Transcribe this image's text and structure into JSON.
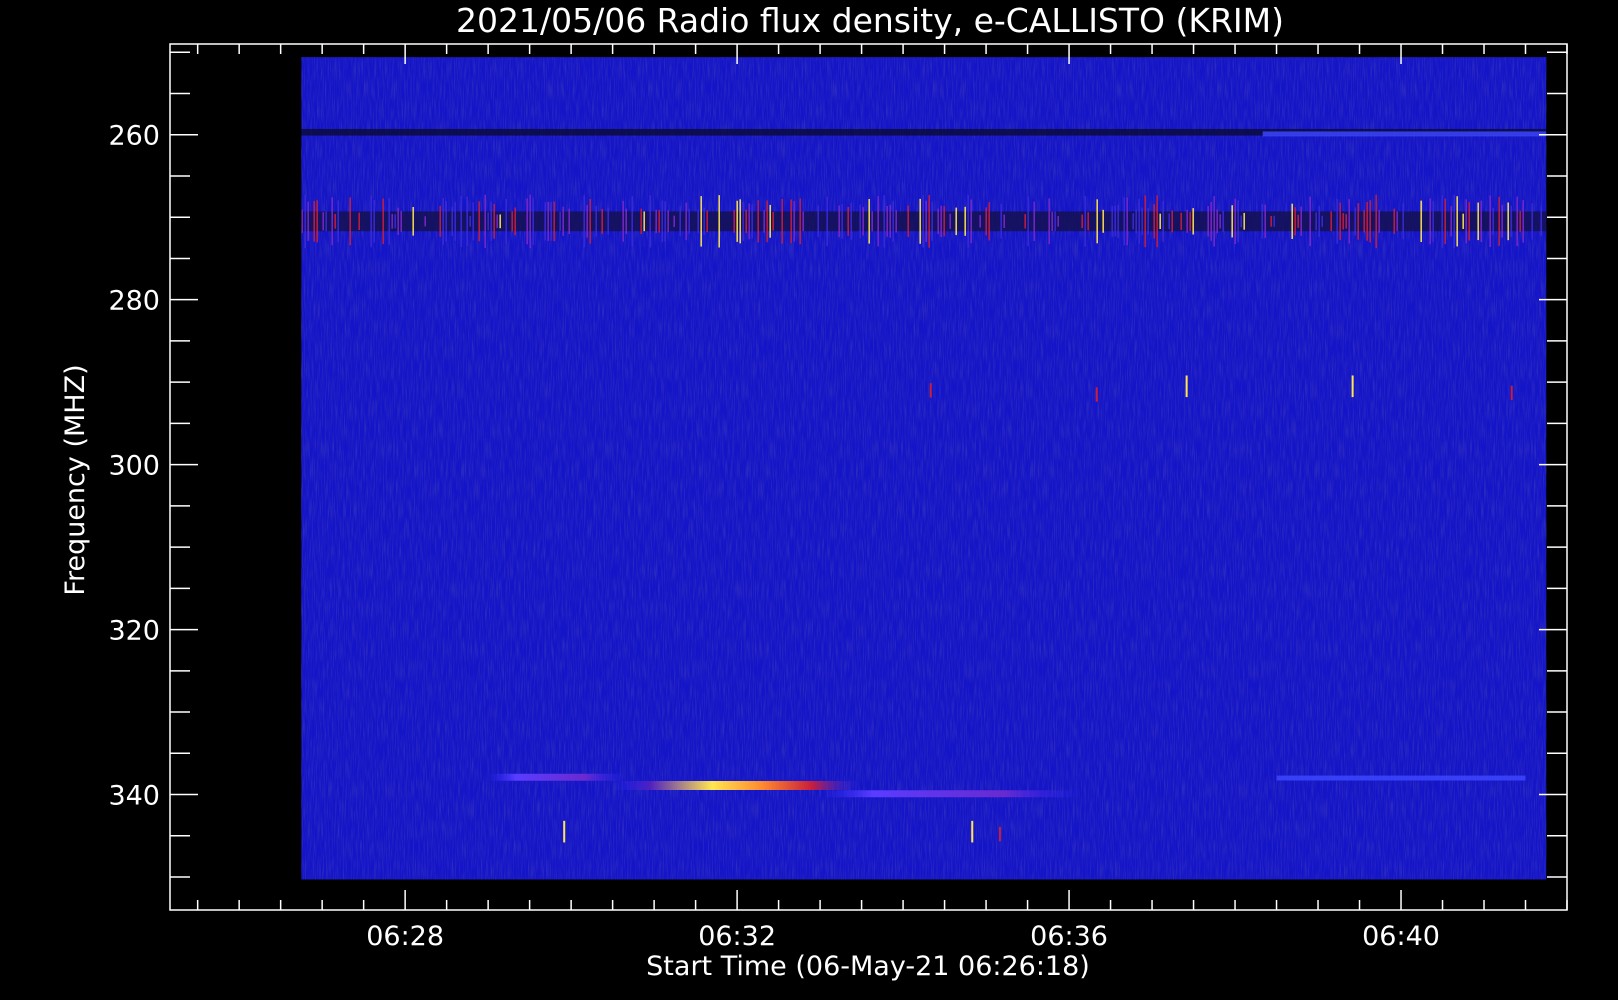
{
  "chart_data": {
    "type": "heatmap",
    "title": "2021/05/06  Radio flux density, e-CALLISTO (KRIM)",
    "xlabel": "Start Time (06-May-21 06:26:18)",
    "ylabel": "Frequency (MHZ)",
    "x_range": [
      "06:25:10",
      "06:42:00"
    ],
    "y_range": [
      249,
      354
    ],
    "y_reversed": true,
    "data_x_range": [
      "06:26:45",
      "06:41:45"
    ],
    "data_y_range": [
      250.6,
      350.3
    ],
    "x_ticks": [
      "06:28",
      "06:32",
      "06:36",
      "06:40"
    ],
    "y_ticks": [
      260,
      280,
      300,
      320,
      340
    ],
    "colormap": "blue-red-yellow",
    "colors": {
      "background": "#000000",
      "axis": "#ffffff",
      "low": "#1414c8",
      "mid": "#c81e3c",
      "high": "#ffe650"
    },
    "features": [
      {
        "kind": "band",
        "t_start": "06:26:45",
        "t_end": "06:41:45",
        "freq": 270.5,
        "width_mhz": 2.4,
        "intensity": "high-sparse"
      },
      {
        "kind": "band",
        "t_start": "06:26:45",
        "t_end": "06:41:45",
        "freq": 259.7,
        "width_mhz": 0.8,
        "intensity": "dark"
      },
      {
        "kind": "band",
        "t_start": "06:38:20",
        "t_end": "06:41:45",
        "freq": 259.9,
        "width_mhz": 0.6,
        "intensity": "low-bright"
      },
      {
        "kind": "burst",
        "t_start": "06:29:00",
        "t_end": "06:30:40",
        "freq": 337.9,
        "intensity": "medium"
      },
      {
        "kind": "burst",
        "t_start": "06:30:30",
        "t_end": "06:33:30",
        "freq": 338.9,
        "intensity": "high"
      },
      {
        "kind": "burst",
        "t_start": "06:33:00",
        "t_end": "06:36:10",
        "freq": 339.9,
        "intensity": "medium"
      },
      {
        "kind": "band",
        "t_start": "06:38:30",
        "t_end": "06:41:30",
        "freq": 338.0,
        "width_mhz": 0.6,
        "intensity": "low-bright"
      },
      {
        "kind": "spike",
        "t": "06:34:20",
        "freq": 291.0,
        "intensity": "medium"
      },
      {
        "kind": "spike",
        "t": "06:36:20",
        "freq": 291.5,
        "intensity": "medium"
      },
      {
        "kind": "spike",
        "t": "06:37:25",
        "freq": 290.5,
        "intensity": "high"
      },
      {
        "kind": "spike",
        "t": "06:39:25",
        "freq": 290.5,
        "intensity": "high"
      },
      {
        "kind": "spike",
        "t": "06:41:20",
        "freq": 291.3,
        "intensity": "medium"
      },
      {
        "kind": "spike",
        "t": "06:29:55",
        "freq": 344.5,
        "intensity": "high"
      },
      {
        "kind": "spike",
        "t": "06:34:50",
        "freq": 344.5,
        "intensity": "high"
      },
      {
        "kind": "spike",
        "t": "06:35:10",
        "freq": 344.8,
        "intensity": "medium"
      }
    ]
  }
}
